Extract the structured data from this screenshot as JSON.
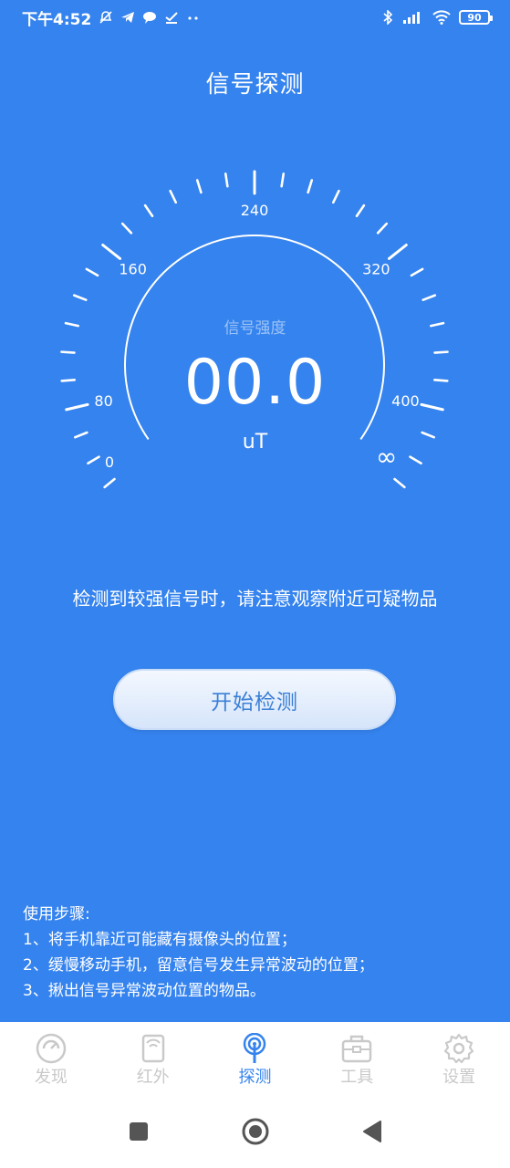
{
  "status_bar": {
    "time": "下午4:52",
    "battery": "90",
    "left_icons": [
      "mute-icon",
      "telegram-icon",
      "chat-bubble-icon",
      "check-icon",
      "more-dots-icon"
    ],
    "right_icons": [
      "bluetooth-icon",
      "signal-icon",
      "wifi-icon",
      "battery-icon"
    ]
  },
  "page": {
    "title": "信号探测"
  },
  "gauge": {
    "caption": "信号强度",
    "value": "00.0",
    "unit": "uT",
    "tick_labels": [
      "0",
      "80",
      "160",
      "240",
      "320",
      "400"
    ],
    "max_label": "∞"
  },
  "hint": "检测到较强信号时，请注意观察附近可疑物品",
  "start_button": "开始检测",
  "steps": {
    "title": "使用步骤:",
    "items": [
      "1、将手机靠近可能藏有摄像头的位置；",
      "2、缓慢移动手机，留意信号发生异常波动的位置；",
      "3、揪出信号异常波动位置的物品。"
    ]
  },
  "bottom_nav": {
    "items": [
      {
        "label": "发现",
        "icon": "gauge-icon",
        "active": false
      },
      {
        "label": "红外",
        "icon": "infrared-icon",
        "active": false
      },
      {
        "label": "探测",
        "icon": "signal-probe-icon",
        "active": true
      },
      {
        "label": "工具",
        "icon": "toolbox-icon",
        "active": false
      },
      {
        "label": "设置",
        "icon": "gear-icon",
        "active": false
      }
    ]
  },
  "colors": {
    "background": "#3583ee",
    "accent": "#3583ee",
    "inactive": "#c9c9c9"
  }
}
